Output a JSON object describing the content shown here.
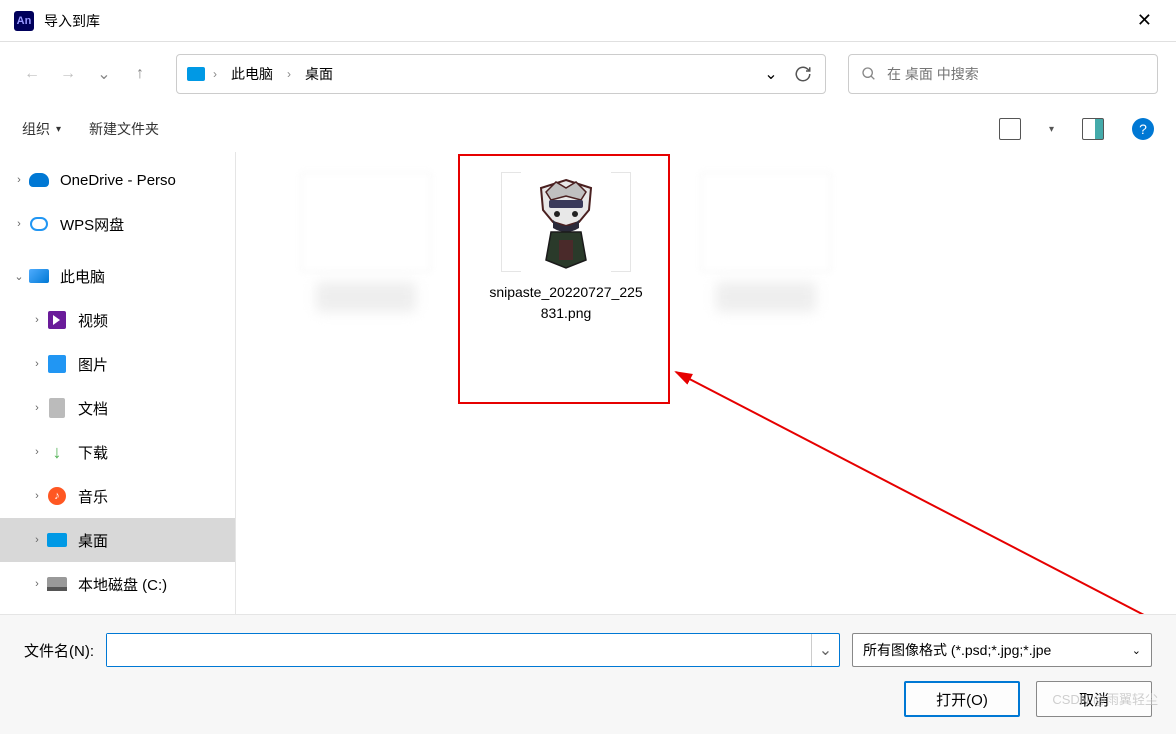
{
  "title": "导入到库",
  "app_icon_text": "An",
  "breadcrumbs": {
    "root": "此电脑",
    "current": "桌面"
  },
  "search": {
    "placeholder": "在 桌面 中搜索"
  },
  "toolbar": {
    "organize": "组织",
    "new_folder": "新建文件夹"
  },
  "sidebar": {
    "items": [
      {
        "label": "OneDrive - Perso",
        "icon": "onedrive",
        "indent": 0,
        "expanded": false,
        "chev": "›"
      },
      {
        "label": "WPS网盘",
        "icon": "wps",
        "indent": 0,
        "expanded": false,
        "chev": "›"
      },
      {
        "label": "此电脑",
        "icon": "pc",
        "indent": 0,
        "expanded": true,
        "chev": "⌄"
      },
      {
        "label": "视频",
        "icon": "video",
        "indent": 1,
        "chev": "›"
      },
      {
        "label": "图片",
        "icon": "image",
        "indent": 1,
        "chev": "›"
      },
      {
        "label": "文档",
        "icon": "doc",
        "indent": 1,
        "chev": "›"
      },
      {
        "label": "下载",
        "icon": "download",
        "indent": 1,
        "chev": "›"
      },
      {
        "label": "音乐",
        "icon": "music",
        "indent": 1,
        "chev": "›"
      },
      {
        "label": "桌面",
        "icon": "desktop",
        "indent": 1,
        "chev": "›",
        "selected": true
      },
      {
        "label": "本地磁盘 (C:)",
        "icon": "disk",
        "indent": 1,
        "chev": "›"
      }
    ]
  },
  "files": {
    "highlighted": {
      "name": "snipaste_20220727_225831.png"
    }
  },
  "bottom": {
    "filename_label": "文件名(N):",
    "filename_value": "",
    "filter": "所有图像格式 (*.psd;*.jpg;*.jpe",
    "open": "打开(O)",
    "cancel": "取消"
  },
  "watermark": "CSDN @雨翼轻尘"
}
